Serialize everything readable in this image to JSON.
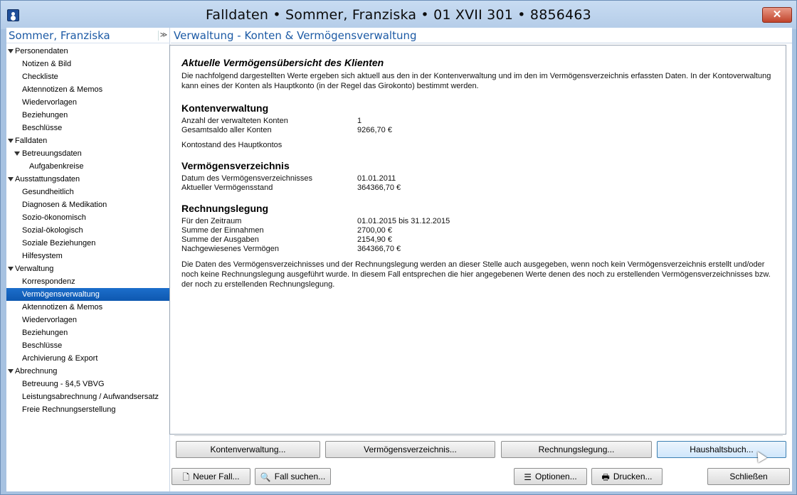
{
  "window": {
    "title": "Falldaten  •  Sommer, Franziska  •  01 XVII 301  •  8856463",
    "close_label": "✕"
  },
  "sidebar": {
    "title": "Sommer, Franziska",
    "toggle_label": "≫",
    "items": [
      {
        "label": "Personendaten",
        "level": 0,
        "expandable": true
      },
      {
        "label": "Notizen & Bild",
        "level": 1
      },
      {
        "label": "Checkliste",
        "level": 1
      },
      {
        "label": "Aktennotizen & Memos",
        "level": 1
      },
      {
        "label": "Wiedervorlagen",
        "level": 1
      },
      {
        "label": "Beziehungen",
        "level": 1
      },
      {
        "label": "Beschlüsse",
        "level": 1
      },
      {
        "label": "Falldaten",
        "level": 0,
        "expandable": true
      },
      {
        "label": "Betreuungsdaten",
        "level": 1,
        "expandable": true
      },
      {
        "label": "Aufgabenkreise",
        "level": 2
      },
      {
        "label": "Ausstattungsdaten",
        "level": 0,
        "expandable": true
      },
      {
        "label": "Gesundheitlich",
        "level": 1
      },
      {
        "label": "Diagnosen & Medikation",
        "level": 1
      },
      {
        "label": "Sozio-ökonomisch",
        "level": 1
      },
      {
        "label": "Sozial-ökologisch",
        "level": 1
      },
      {
        "label": "Soziale Beziehungen",
        "level": 1
      },
      {
        "label": "Hilfesystem",
        "level": 1
      },
      {
        "label": "Verwaltung",
        "level": 0,
        "expandable": true
      },
      {
        "label": "Korrespondenz",
        "level": 1
      },
      {
        "label": "Vermögensverwaltung",
        "level": 1,
        "selected": true
      },
      {
        "label": "Aktennotizen & Memos",
        "level": 1
      },
      {
        "label": "Wiedervorlagen",
        "level": 1
      },
      {
        "label": "Beziehungen",
        "level": 1
      },
      {
        "label": "Beschlüsse",
        "level": 1
      },
      {
        "label": "Archivierung & Export",
        "level": 1
      },
      {
        "label": "Abrechnung",
        "level": 0,
        "expandable": true
      },
      {
        "label": "Betreuung - §4,5 VBVG",
        "level": 1
      },
      {
        "label": "Leistungsabrechnung / Aufwandsersatz",
        "level": 1
      },
      {
        "label": "Freie Rechnungserstellung",
        "level": 1
      }
    ]
  },
  "main": {
    "title": "Verwaltung - Konten & Vermögensverwaltung",
    "heading": "Aktuelle Vermögensübersicht des Klienten",
    "intro": "Die nachfolgend dargestellten Werte ergeben sich aktuell aus den in der Kontenverwaltung und im den im Vermögensverzeichnis erfassten Daten. In der Kontoverwaltung kann eines der Konten als Hauptkonto (in der Regel das Girokonto) bestimmt werden.",
    "konten": {
      "heading": "Kontenverwaltung",
      "anzahl_label": "Anzahl der verwalteten Konten",
      "anzahl_value": "1",
      "saldo_label": "Gesamtsaldo aller Konten",
      "saldo_value": "9266,70 €",
      "hauptkonto_label": "Kontostand des Hauptkontos"
    },
    "verzeichnis": {
      "heading": "Vermögensverzeichnis",
      "datum_label": "Datum des Vermögensverzeichnisses",
      "datum_value": "01.01.2011",
      "stand_label": "Aktueller Vermögensstand",
      "stand_value": "364366,70 €"
    },
    "rechnung": {
      "heading": "Rechnungslegung",
      "zeitraum_label": "Für den Zeitraum",
      "zeitraum_value": "01.01.2015 bis 31.12.2015",
      "einnahmen_label": "Summe der Einnahmen",
      "einnahmen_value": "2700,00 €",
      "ausgaben_label": "Summe der Ausgaben",
      "ausgaben_value": "2154,90 €",
      "nachgewiesen_label": "Nachgewiesenes Vermögen",
      "nachgewiesen_value": "364366,70 €"
    },
    "footer_note": "Die Daten des Vermögensverzeichnisses und der Rechnungslegung werden an dieser Stelle auch ausgegeben, wenn noch kein Vermögensverzeichnis erstellt und/oder noch keine Rechnungslegung ausgeführt wurde. In diesem Fall entsprechen die hier angegebenen Werte denen des noch zu erstellenden Vermögensverzeichnisses bzw. der noch zu erstellenden Rechnungslegung."
  },
  "actions": {
    "kontenverwaltung": "Kontenverwaltung...",
    "vermoegensverzeichnis": "Vermögensverzeichnis...",
    "rechnungslegung": "Rechnungslegung...",
    "haushaltsbuch": "Haushaltsbuch..."
  },
  "bottom": {
    "neuer_fall": "Neuer Fall...",
    "fall_suchen": "Fall suchen...",
    "optionen": "Optionen...",
    "drucken": "Drucken...",
    "schliessen": "Schließen"
  }
}
